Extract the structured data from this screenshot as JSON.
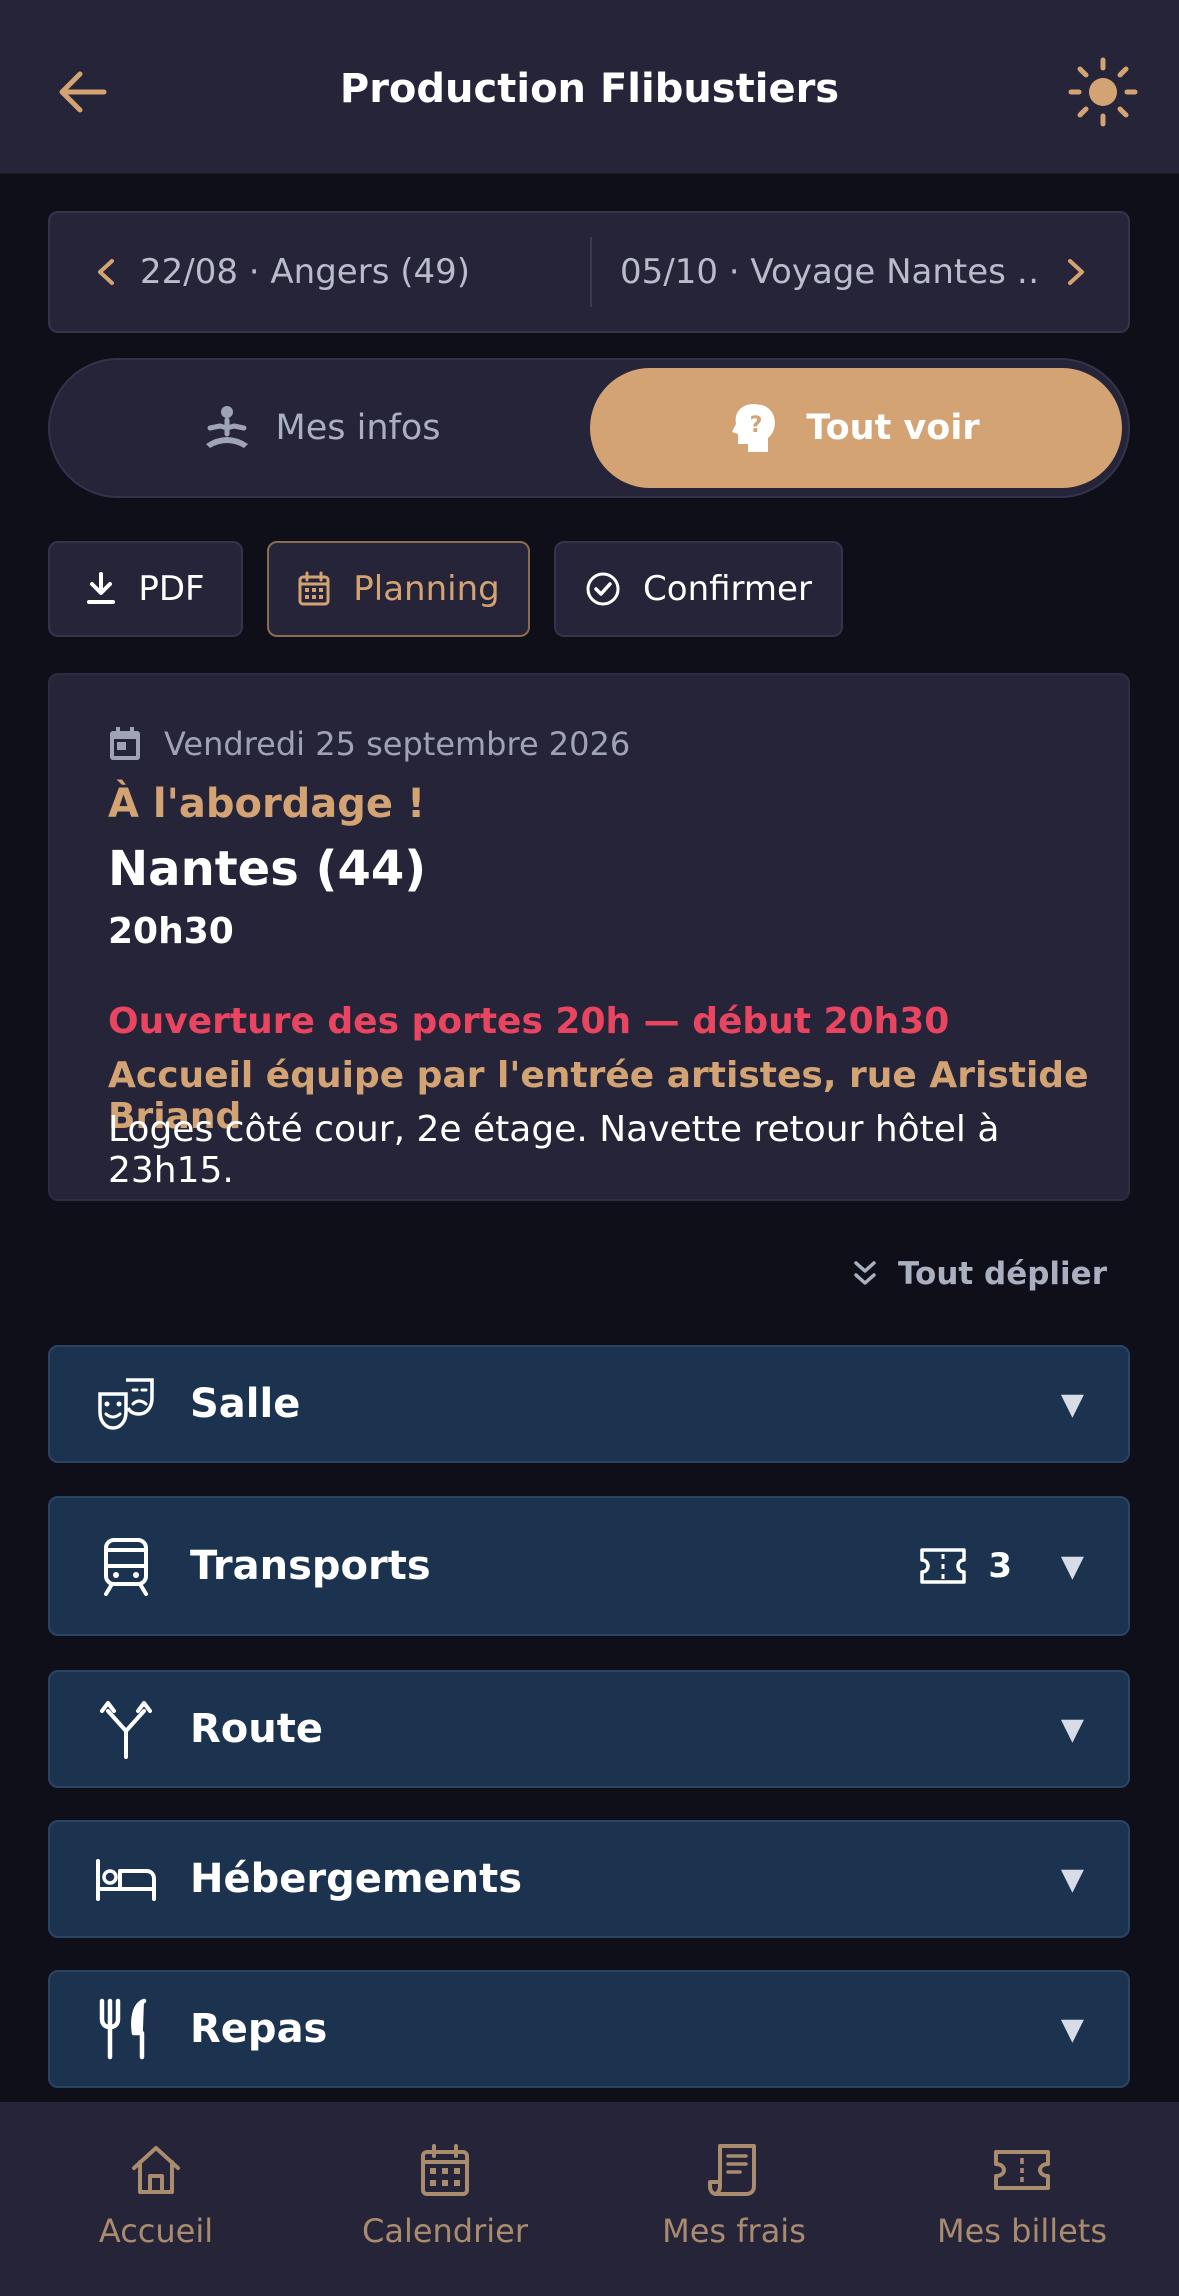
{
  "header": {
    "title": "Production Flibustiers"
  },
  "date_nav": {
    "prev_label": "22/08 · Angers (49)",
    "next_label": "05/10 · Voyage Nantes …"
  },
  "view_toggle": {
    "options": [
      "Mes infos",
      "Tout voir"
    ],
    "selected": "Tout voir"
  },
  "actions": {
    "pdf_label": "PDF",
    "planning_label": "Planning",
    "confirm_label": "Confirmer"
  },
  "event": {
    "date": "Vendredi 25 septembre 2026",
    "show_title": "À l'abordage !",
    "city": "Nantes (44)",
    "time": "20h30",
    "note_alert": "Ouverture des portes 20h — début 20h30",
    "note_highlight": "Accueil équipe par l'entrée artistes, rue Aristide Briand",
    "note_info": "Loges côté cour, 2e étage. Navette retour hôtel à 23h15."
  },
  "expand_all_label": "Tout déplier",
  "sections": [
    {
      "label": "Salle",
      "icon": "theater-masks-icon"
    },
    {
      "label": "Transports",
      "icon": "train-icon",
      "ticket_count": "3"
    },
    {
      "label": "Route",
      "icon": "route-fork-icon"
    },
    {
      "label": "Hébergements",
      "icon": "bed-icon"
    },
    {
      "label": "Repas",
      "icon": "utensils-icon"
    }
  ],
  "bottom_nav": {
    "items": [
      {
        "label": "Accueil",
        "icon": "home-icon"
      },
      {
        "label": "Calendrier",
        "icon": "calendar-icon"
      },
      {
        "label": "Mes frais",
        "icon": "receipt-icon"
      },
      {
        "label": "Mes billets",
        "icon": "ticket-icon"
      }
    ]
  },
  "colors": {
    "accent": "#d4a373",
    "alert": "#e94560",
    "background": "#0f0f1a",
    "surface": "#252439",
    "section": "#1c3350"
  }
}
